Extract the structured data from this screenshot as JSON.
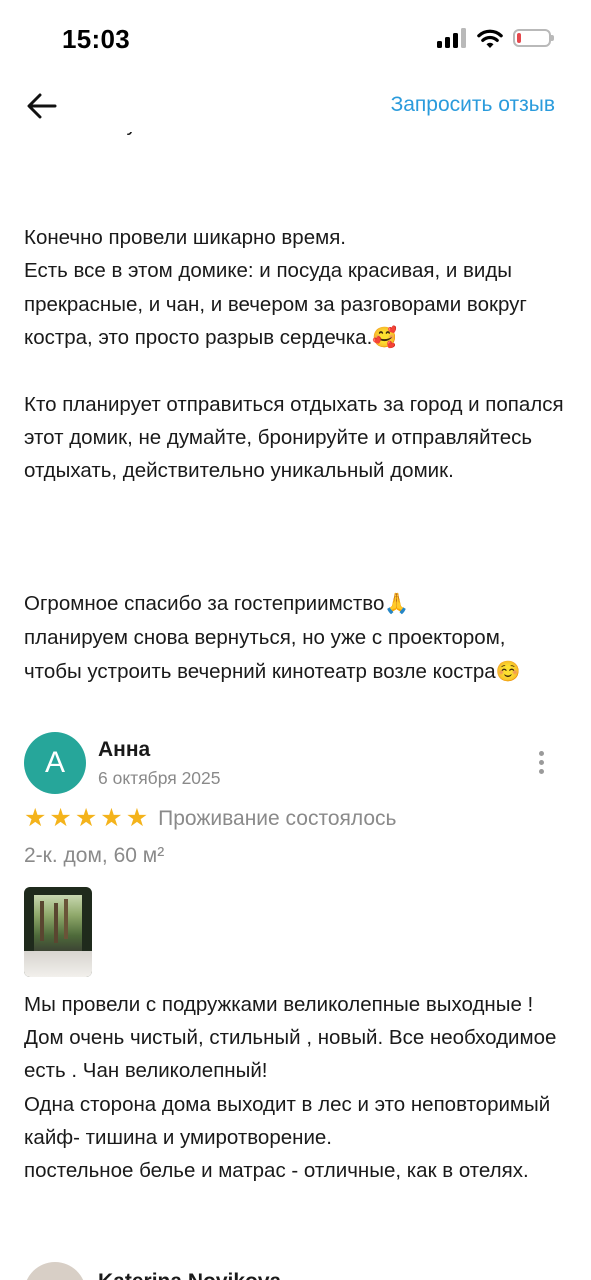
{
  "status_bar": {
    "time": "15:03",
    "battery_level": 0.12,
    "battery_color": "#e5484d"
  },
  "nav": {
    "back_icon": "arrow-left-icon",
    "request_review_label": "Запросить отзыв",
    "accent_color": "#2a9bdc"
  },
  "previous_review": {
    "partial_line": "ни по плану.",
    "paragraph_1": "Конечно провели шикарно время.\nЕсть все в этом домике: и посуда красивая, и виды прекрасные, и чан, и вечером за разговорами вокруг костра, это просто разрыв сердечка.",
    "emoji_1": "🥰",
    "paragraph_2": "Кто планирует отправиться отдыхать за город и попался этот домик, не думайте, бронируйте и отправляйтесь отдыхать, действительно уникальный домик.",
    "paragraph_3_a": "Огромное спасибо за гостеприимство",
    "emoji_2": "🙏",
    "paragraph_3_b": "\nпланируем снова вернуться, но уже с проектором, чтобы устроить вечерний кинотеатр возле костра",
    "emoji_3": "☺️"
  },
  "review_anna": {
    "avatar_letter": "А",
    "avatar_color": "#26a69a",
    "author": "Анна",
    "date": "6 октября 2025",
    "stars": 5,
    "stay_status": "Проживание состоялось",
    "property": "2-к. дом, 60 м²",
    "photo_icon": "review-photo-thumbnail",
    "text": "Мы провели с подружками великолепные выходные ! Дом очень чистый, стильный , новый. Все необходимое есть . Чан великолепный!\nОдна сторона дома выходит в лес  и это неповторимый кайф- тишина и умиротворение.\nпостельное белье и матрас - отличные, как в отелях."
  },
  "review_next": {
    "author": "Katerina Novikova",
    "avatar_color": "#d8cfc6"
  }
}
